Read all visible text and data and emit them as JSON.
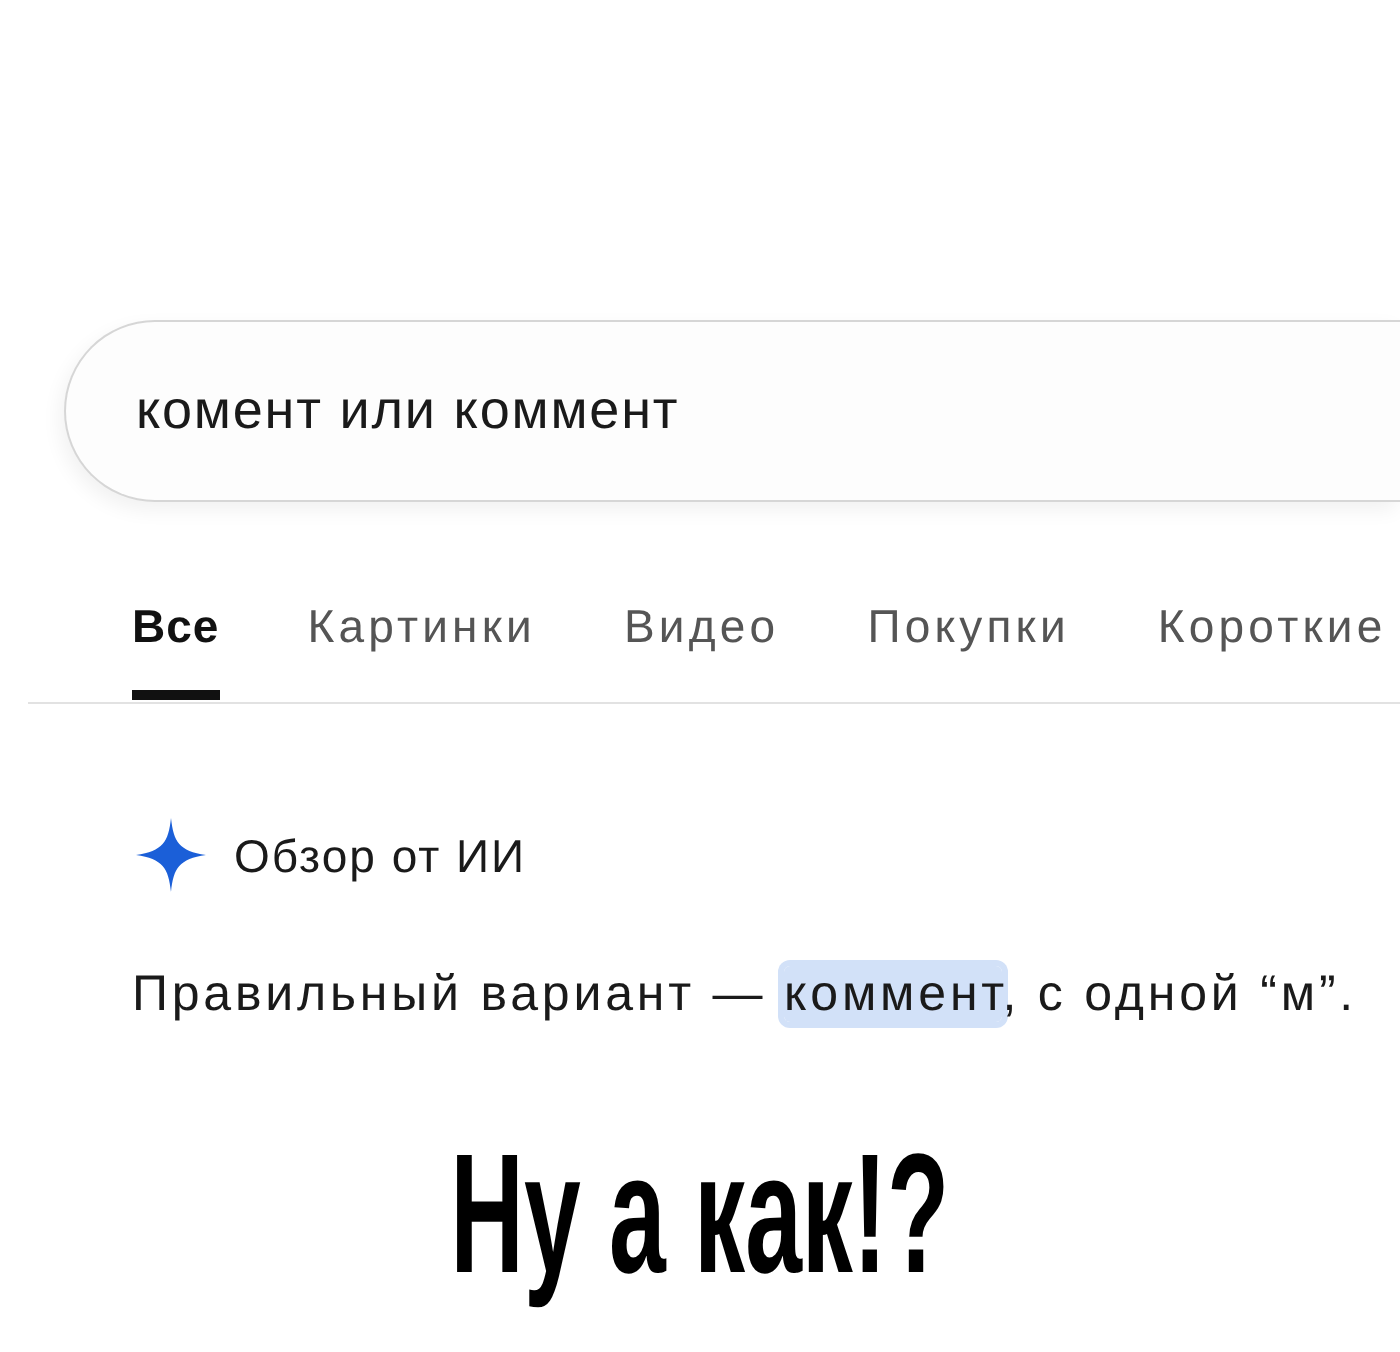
{
  "search": {
    "value": "комент или коммент"
  },
  "tabs": [
    {
      "label": "Все",
      "selected": true
    },
    {
      "label": "Картинки",
      "selected": false
    },
    {
      "label": "Видео",
      "selected": false
    },
    {
      "label": "Покупки",
      "selected": false
    },
    {
      "label": "Короткие",
      "selected": false
    }
  ],
  "ai_overview": {
    "title": "Обзор от ИИ",
    "answer": {
      "before": "Правильный вариант — ",
      "highlight": "коммент",
      "after": ", с одной “м”."
    }
  },
  "caption": "Ну а как!?"
}
